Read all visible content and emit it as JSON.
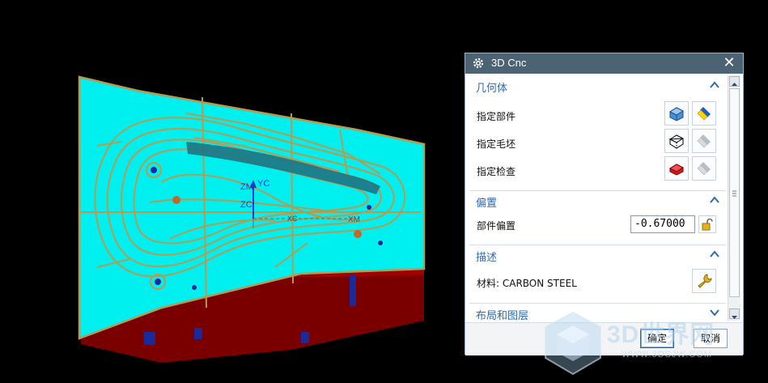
{
  "dialog": {
    "title": "3D Cnc",
    "close_symbol": "✕",
    "sections": {
      "geometry": {
        "label": "几何体",
        "rows": {
          "part": "指定部件",
          "blank": "指定毛坯",
          "check": "指定检查"
        }
      },
      "offset": {
        "label": "偏置",
        "part_offset_label": "部件偏置",
        "part_offset_value": "-0.67000"
      },
      "description": {
        "label": "描述",
        "material": "材料: CARBON STEEL"
      },
      "layout": {
        "label": "布局和图层"
      }
    },
    "buttons": {
      "ok": "确定",
      "cancel": "取消"
    }
  },
  "viewport": {
    "axis_labels": {
      "yc": "YC",
      "zm": "ZM",
      "zc": "ZC",
      "xc": "XC",
      "xm": "XM"
    }
  },
  "watermark": {
    "text": "3D世界网",
    "url": "WWW.3DSJW.COM"
  },
  "colors": {
    "part_fill": "#00f0f0",
    "outline": "#b89a4f",
    "base": "#7a0000",
    "accent": "#2f6ab1",
    "titlebar": "#4c6374"
  }
}
